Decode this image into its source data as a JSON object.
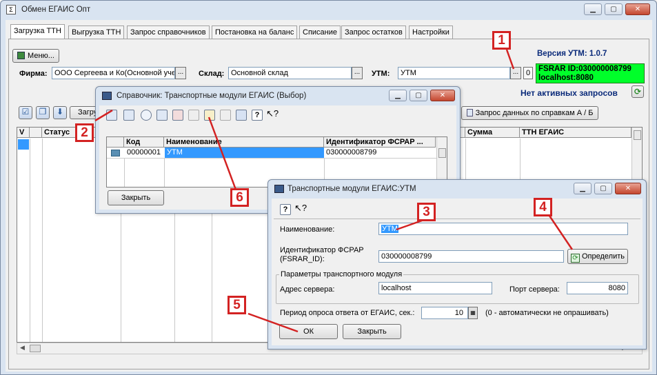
{
  "main_window": {
    "title": "Обмен ЕГАИС Опт",
    "tabs": [
      "Загрузка ТТН",
      "Выгрузка ТТН",
      "Запрос справочников",
      "Постановка на баланс",
      "Списание",
      "Запрос остатков",
      "Настройки"
    ],
    "menu_button": "Меню...",
    "firm_label": "Фирма:",
    "firm_value": "ООО Сергеева и Ко(Основной уче",
    "warehouse_label": "Склад:",
    "warehouse_value": "Основной склад",
    "utm_label": "УТМ:",
    "utm_value": "УТМ",
    "utm_count": "0",
    "utm_version": "Версия УТМ: 1.0.7",
    "fsrar_line": "FSRAR ID:030000008799",
    "host_line": "localhost:8080",
    "no_requests": "Нет активных запросов",
    "load_button": "Загру",
    "request_button": "Запрос данных по справкам А / Б",
    "grid_columns": [
      "V",
      "",
      "Статус",
      "Сумма",
      "ТТН ЕГАИС"
    ],
    "status_color": "#00ff2a",
    "version_color": "#0a2a7a"
  },
  "directory_window": {
    "title": "Справочник: Транспортные модули ЕГАИС (Выбор)",
    "columns": [
      "Код",
      "Наименование",
      "Идентификатор ФСРАР ..."
    ],
    "rows": [
      {
        "code": "00000001",
        "name": "УТМ",
        "fsrar": "030000008799"
      }
    ],
    "close_button": "Закрыть"
  },
  "form_window": {
    "title": "Транспортные модули ЕГАИС:УТМ",
    "name_label": "Наименование:",
    "name_value": "УТМ",
    "fsrar_label_1": "Идентификатор ФСРАР",
    "fsrar_label_2": "(FSRAR_ID):",
    "fsrar_value": "030000008799",
    "detect_button": "Определить",
    "group_title": "Параметры транспортного модуля",
    "server_label": "Адрес сервера:",
    "server_value": "localhost",
    "port_label": "Порт сервера:",
    "port_value": "8080",
    "period_label": "Период опроса ответа от ЕГАИС, сек.:",
    "period_value": "10",
    "period_hint": "(0 - автоматически не опрашивать)",
    "ok_button": "ОК",
    "close_button": "Закрыть"
  },
  "callouts": [
    "1",
    "2",
    "3",
    "4",
    "5",
    "6"
  ],
  "annotation_color": "#d32222"
}
